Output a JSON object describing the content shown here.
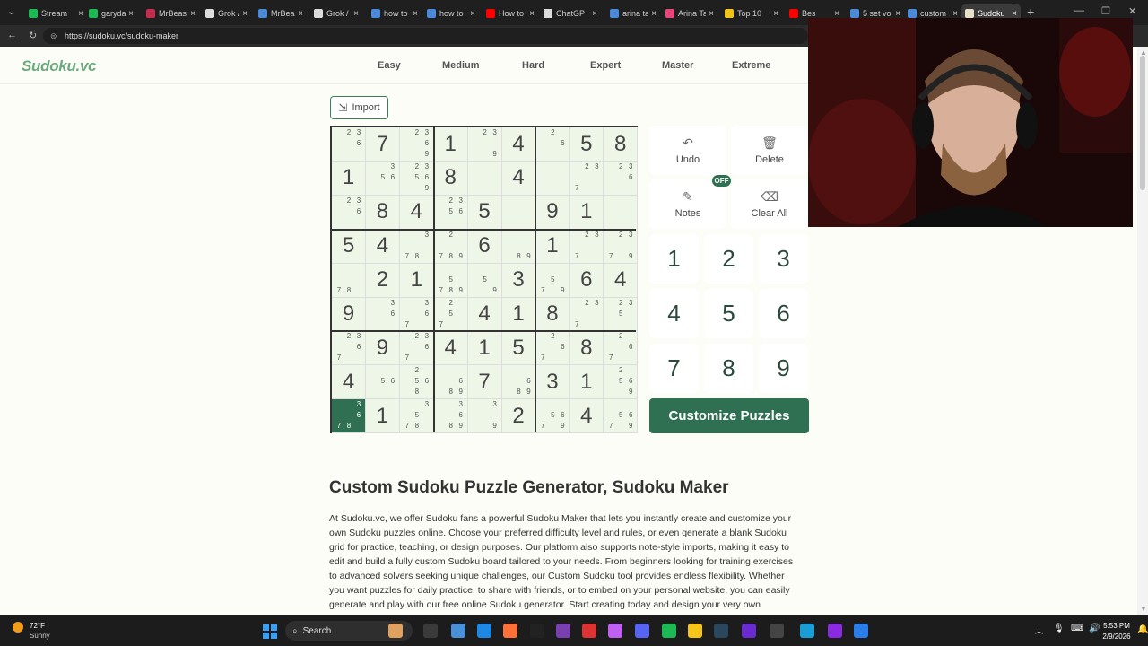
{
  "browser": {
    "tabs": [
      {
        "label": "Stream",
        "color": "#1db954"
      },
      {
        "label": "garyda",
        "color": "#1db954"
      },
      {
        "label": "MrBeas",
        "color": "#c62d4d"
      },
      {
        "label": "Grok / X",
        "color": "#dddddd"
      },
      {
        "label": "MrBeas",
        "color": "#4a8ad8"
      },
      {
        "label": "Grok / X",
        "color": "#dddddd"
      },
      {
        "label": "how to",
        "color": "#4a8ad8"
      },
      {
        "label": "how to",
        "color": "#4a8ad8"
      },
      {
        "label": "How to",
        "color": "#ff0000"
      },
      {
        "label": "ChatGP",
        "color": "#dddddd"
      },
      {
        "label": "arina ta",
        "color": "#4a8ad8"
      },
      {
        "label": "Arina Ta",
        "color": "#e8457a"
      },
      {
        "label": "Top 10",
        "color": "#f0c419"
      },
      {
        "label": "Bes",
        "color": "#ff0000"
      },
      {
        "label": "5 set vo",
        "color": "#4a8ad8"
      },
      {
        "label": "custom",
        "color": "#4a8ad8"
      },
      {
        "label": "Sudoku",
        "color": "#e8e0c8",
        "active": true
      }
    ],
    "url": "https://sudoku.vc/sudoku-maker"
  },
  "site": {
    "logo": "Sudoku.vc",
    "nav": [
      "Easy",
      "Medium",
      "Hard",
      "Expert",
      "Master",
      "Extreme"
    ]
  },
  "import_label": "Import",
  "board": {
    "values": [
      "_7_1_4_58",
      "1__8_4___",
      "_84_5_91_",
      "54__6_1__",
      "_21__3_64",
      "9___418__",
      "_9_415_8_",
      "4___7_31_",
      "_1___2_4_"
    ],
    "notes": [
      [
        "236",
        "",
        "2369",
        "",
        "239",
        "",
        "26",
        "",
        ""
      ],
      [
        "",
        "356",
        "23569",
        "23569",
        "",
        "69",
        "",
        "237",
        "236"
      ],
      [
        "236",
        "",
        "",
        "2356",
        "235",
        "",
        "26",
        "",
        ""
      ],
      [
        "",
        "",
        "378",
        "2789",
        "",
        "89",
        "",
        "237",
        "2379"
      ],
      [
        "78",
        "",
        "",
        "5789",
        "59",
        "",
        "579",
        "",
        ""
      ],
      [
        "",
        "36",
        "367",
        "257",
        "",
        "",
        "",
        "237",
        "235"
      ],
      [
        "2367",
        "",
        "2367",
        "",
        "",
        "",
        "267",
        "",
        "267"
      ],
      [
        "",
        "56",
        "2568",
        "689",
        "",
        "689",
        "",
        "",
        "2569"
      ],
      [
        "3678",
        "",
        "3578",
        "3689",
        "39",
        "",
        "5679",
        "",
        "5679"
      ]
    ],
    "selected": [
      8,
      0
    ]
  },
  "controls": {
    "undo": "Undo",
    "delete": "Delete",
    "notes": "Notes",
    "notes_state": "OFF",
    "clear_all": "Clear All"
  },
  "numpad": [
    "1",
    "2",
    "3",
    "4",
    "5",
    "6",
    "7",
    "8",
    "9"
  ],
  "customize_label": "Customize Puzzles",
  "article": {
    "title": "Custom Sudoku Puzzle Generator, Sudoku Maker",
    "lines": [
      "At Sudoku.vc, we offer Sudoku fans a powerful Sudoku Maker that lets you instantly create and customize your",
      "own Sudoku puzzles online. Choose your preferred difficulty level and rules, or even generate a blank Sudoku",
      "grid for practice, teaching, or design purposes. Our platform also supports note-style imports, making it easy to",
      "edit and build a fully custom Sudoku board tailored to your needs. From beginners looking for training exercises",
      "to advanced solvers seeking unique challenges, our Custom Sudoku tool provides endless flexibility. Whether",
      "you want puzzles for daily practice, to share with friends, or to embed on your personal website, you can easily",
      "generate and play with our free online Sudoku generator. Start creating today and design your very own"
    ]
  },
  "taskbar": {
    "weather_temp": "72°F",
    "weather_desc": "Sunny",
    "search": "Search",
    "time": "5:53 PM",
    "date": "2/9/2026"
  }
}
